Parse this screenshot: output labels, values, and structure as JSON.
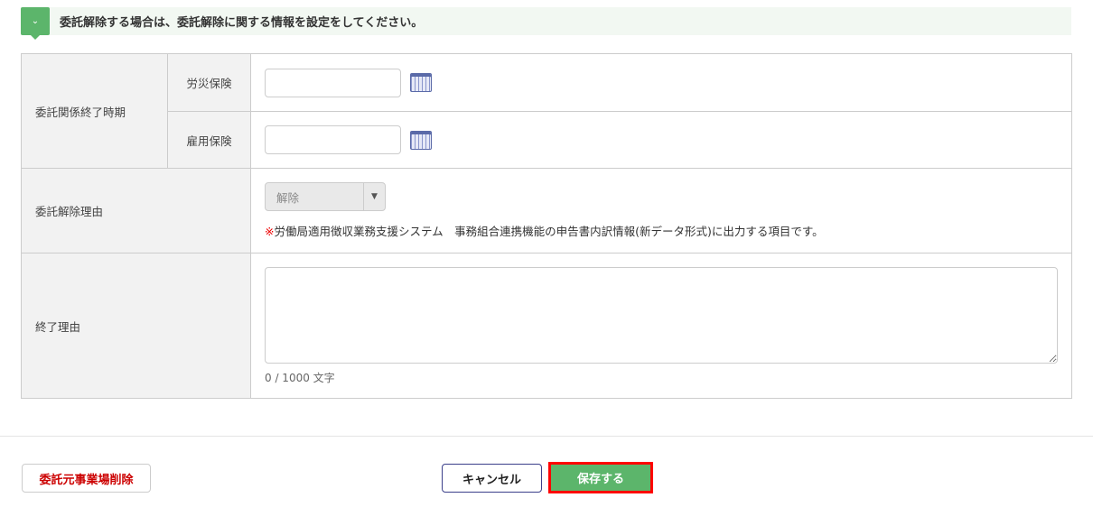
{
  "section": {
    "title": "委託解除する場合は、委託解除に関する情報を設定をしてください。"
  },
  "form": {
    "end_period_label": "委託関係終了時期",
    "rousai_label": "労災保険",
    "koyou_label": "雇用保険",
    "rousai_value": "",
    "koyou_value": "",
    "reason_label": "委託解除理由",
    "reason_selected": "解除",
    "note_mark": "※",
    "note_text": "労働局適用徴収業務支援システム　事務組合連携機能の申告書内訳情報(新データ形式)に出力する項目です。",
    "end_reason_label": "終了理由",
    "end_reason_value": "",
    "char_count": "0 / 1000 文字"
  },
  "footer": {
    "delete_label": "委託元事業場削除",
    "cancel_label": "キャンセル",
    "save_label": "保存する"
  }
}
